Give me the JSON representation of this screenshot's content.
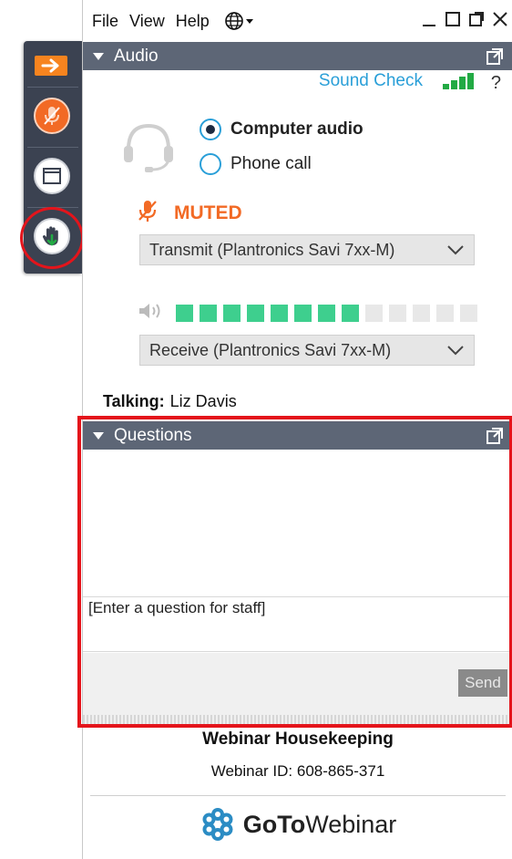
{
  "menu": {
    "file": "File",
    "view": "View",
    "help": "Help"
  },
  "icons": {
    "arrow": "arrow-right-icon",
    "mic": "microphone-muted-icon",
    "window": "window-icon",
    "hand": "raise-hand-icon",
    "globe": "globe-icon",
    "headset": "headset-icon",
    "speaker": "speaker-icon"
  },
  "audio": {
    "header": "Audio",
    "sound_check": "Sound Check",
    "help": "?",
    "computer_audio": "Computer audio",
    "phone_call": "Phone call",
    "selected_option": "Computer audio",
    "muted": "MUTED",
    "transmit": "Transmit (Plantronics Savi 7xx-M)",
    "receive": "Receive (Plantronics Savi 7xx-M)",
    "meter": {
      "total": 13,
      "active": 8
    },
    "talking_label": "Talking:",
    "talking_name": "Liz Davis"
  },
  "questions": {
    "header": "Questions",
    "input_placeholder": "[Enter a question for staff]",
    "send": "Send"
  },
  "footer": {
    "title": "Webinar Housekeeping",
    "webinar_id": "Webinar ID: 608-865-371",
    "brand_bold": "GoTo",
    "brand_rest": "Webinar"
  },
  "colors": {
    "accent_orange": "#f26a25",
    "link_blue": "#2a9fd8",
    "meter_green": "#3ecf8e",
    "header_gray": "#5d6676",
    "highlight_red": "#e4141b"
  }
}
